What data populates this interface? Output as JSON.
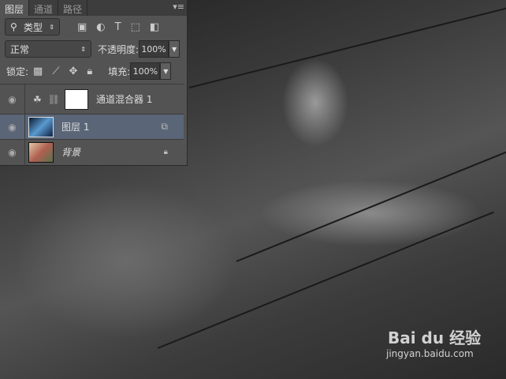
{
  "tabs": [
    "图层",
    "通道",
    "路径"
  ],
  "filter": {
    "label": "类型"
  },
  "blend": {
    "mode": "正常",
    "opacity_label": "不透明度:",
    "opacity": "100%"
  },
  "lock": {
    "label": "锁定:",
    "fill_label": "填充:",
    "fill": "100%"
  },
  "layers": [
    {
      "name": "通道混合器 1",
      "type": "adjustment"
    },
    {
      "name": "图层 1",
      "type": "pixel",
      "selected": true
    },
    {
      "name": "背景",
      "type": "background",
      "locked": true
    }
  ],
  "watermark": {
    "brand": "Bai du 经验",
    "url": "jingyan.baidu.com"
  },
  "colors": {
    "panel": "#535353",
    "selected": "#5a6577"
  }
}
